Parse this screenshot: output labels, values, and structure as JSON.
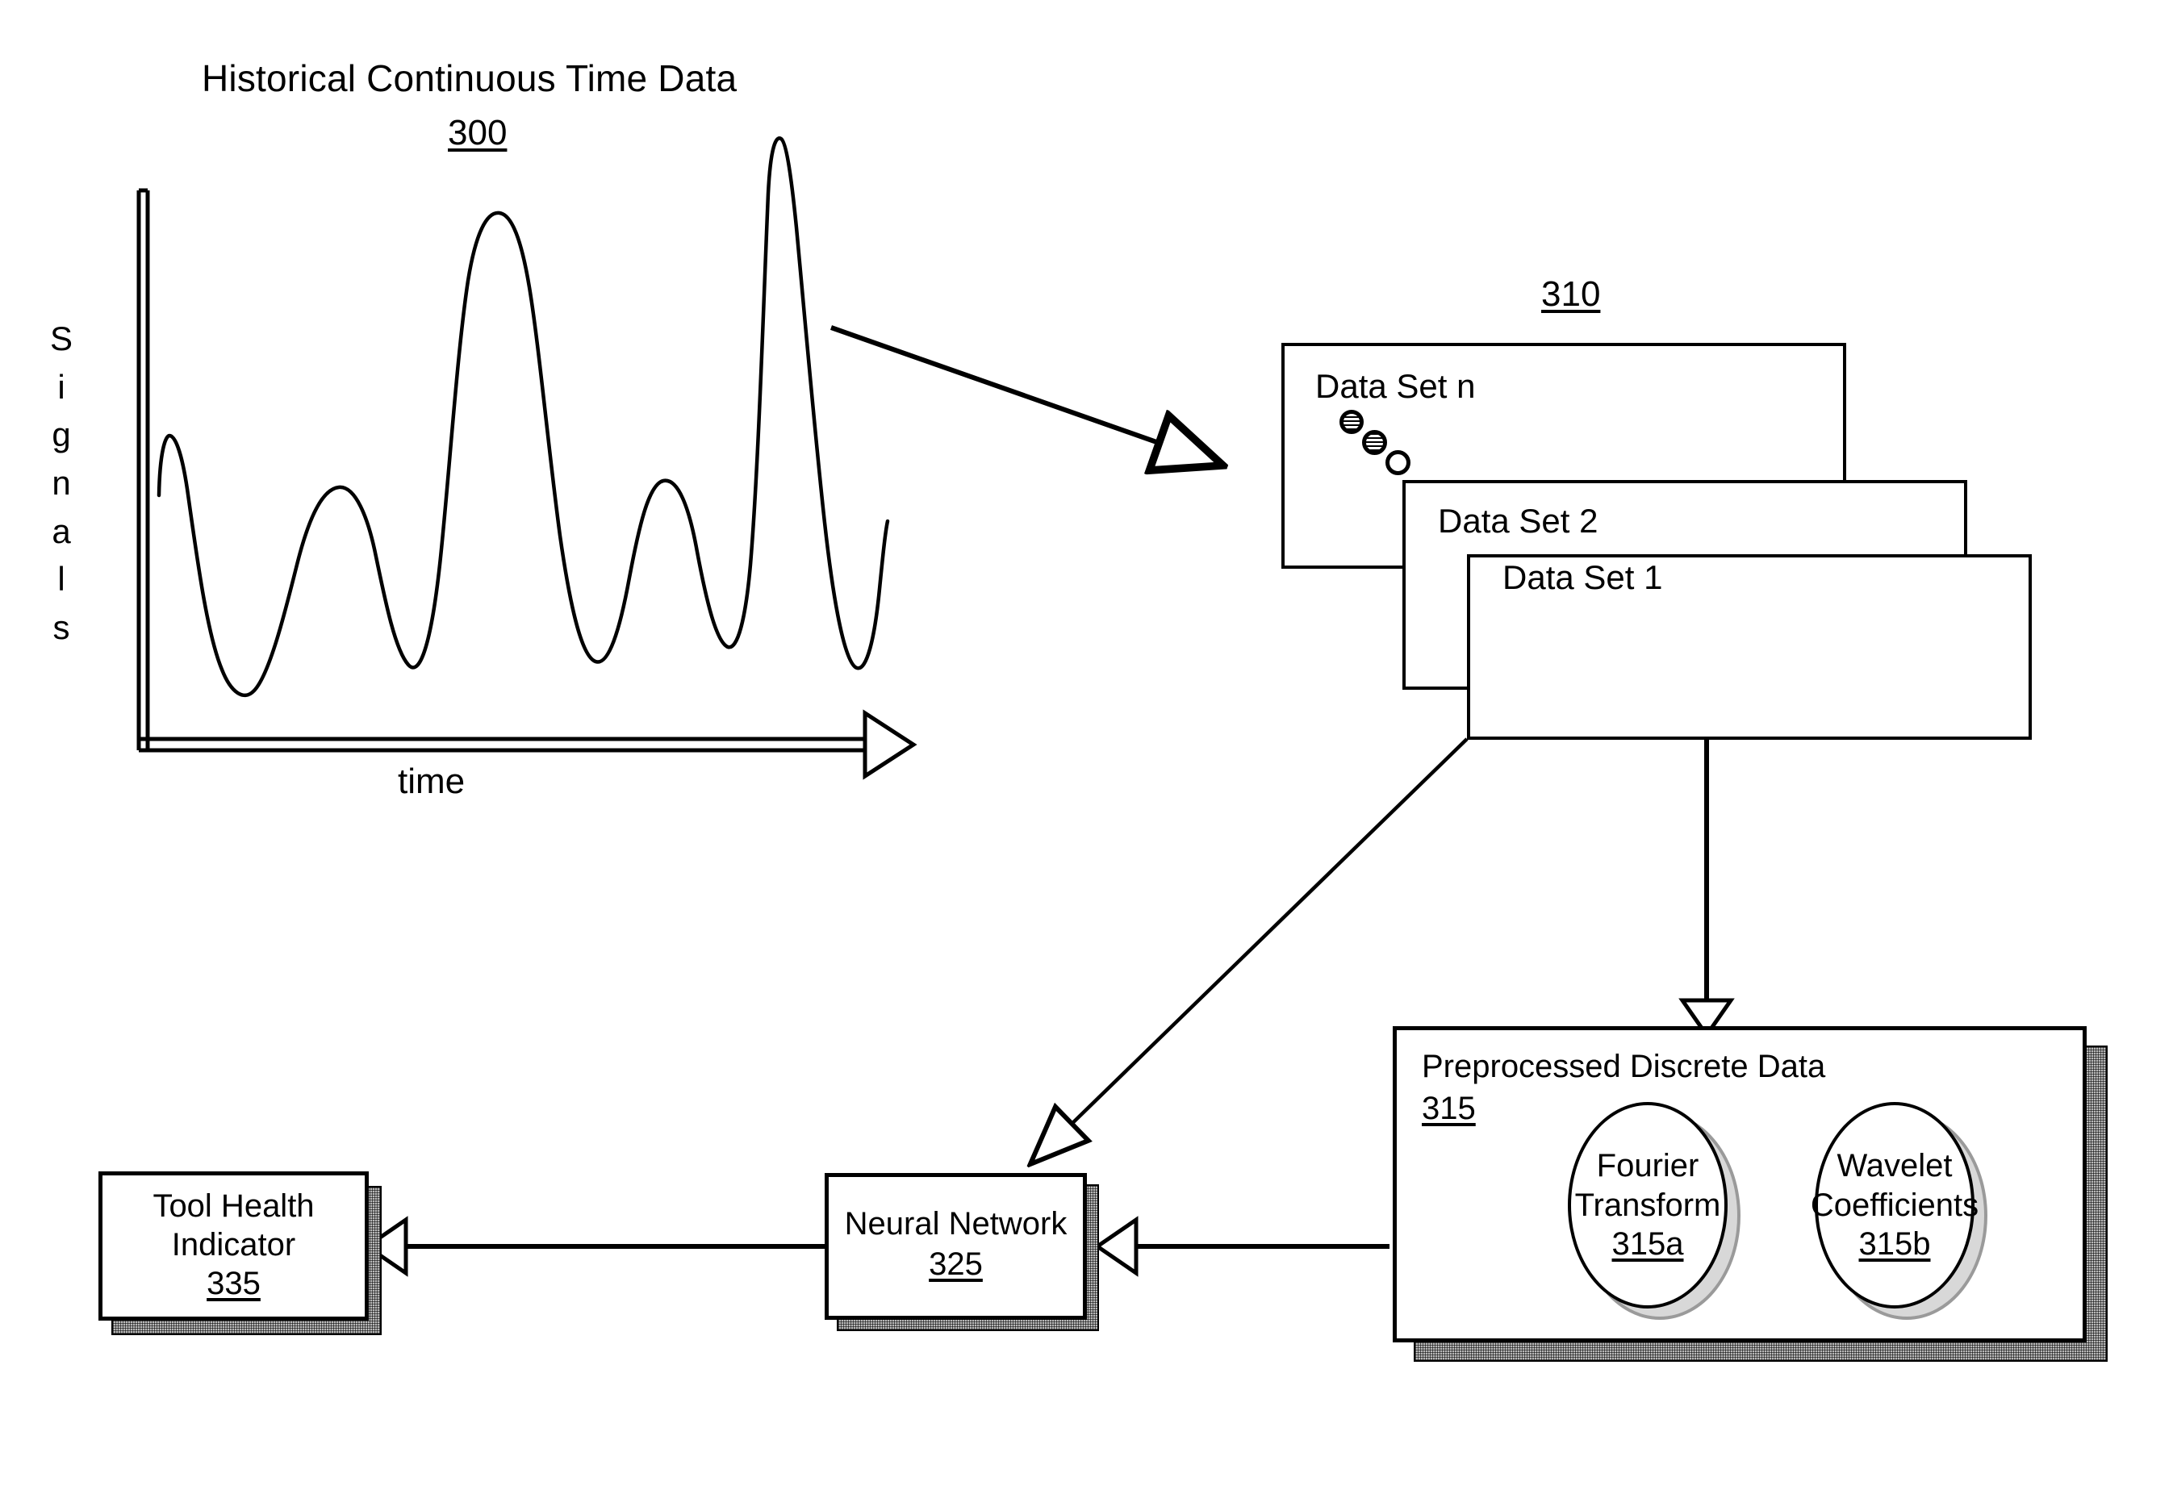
{
  "figure": {
    "title": "Historical Continuous Time Data",
    "title_ref": "300",
    "y_axis_label_letters": [
      "S",
      "i",
      "g",
      "n",
      "a",
      "l",
      "s"
    ],
    "y_axis_label": "Signals",
    "x_axis_label": "time"
  },
  "chart_data": {
    "type": "line",
    "title": "Historical Continuous Time Data",
    "xlabel": "time",
    "ylabel": "Signals",
    "grid": false,
    "legend": null,
    "axis_arrows": true,
    "series": [
      {
        "name": "signal",
        "comment": "normalized 0-1 samples traced off the drawn curve",
        "x": [
          0.0,
          0.01,
          0.04,
          0.12,
          0.2,
          0.26,
          0.31,
          0.36,
          0.42,
          0.47,
          0.5,
          0.53,
          0.56,
          0.6,
          0.64,
          0.69,
          0.74,
          0.78,
          0.8,
          0.81,
          0.845,
          0.88,
          0.93,
          0.97,
          1.0
        ],
        "y": [
          0.5,
          0.56,
          0.52,
          0.24,
          0.06,
          0.17,
          0.37,
          0.29,
          0.1,
          0.42,
          0.76,
          0.83,
          0.72,
          0.38,
          0.1,
          0.26,
          0.36,
          0.25,
          0.12,
          0.62,
          1.0,
          0.8,
          0.4,
          0.1,
          0.3
        ]
      }
    ]
  },
  "data_sets": {
    "ref": "310",
    "boxes": [
      {
        "label": "Data Set n"
      },
      {
        "label": "Data Set 2"
      },
      {
        "label": "Data Set 1"
      }
    ],
    "ellipsis_marker": "diagonal-dots"
  },
  "preprocessed": {
    "title": "Preprocessed Discrete Data",
    "ref": "315",
    "nodes": [
      {
        "line1": "Fourier",
        "line2": "Transform",
        "ref": "315a"
      },
      {
        "line1": "Wavelet",
        "line2": "Coefficients",
        "ref": "315b"
      }
    ]
  },
  "neural_network": {
    "title": "Neural Network",
    "ref": "325"
  },
  "tool_health": {
    "line1": "Tool Health",
    "line2": "Indicator",
    "ref": "335"
  },
  "colors": {
    "stroke": "#000000",
    "fill": "#ffffff",
    "shadow": "#b9b9b9"
  }
}
